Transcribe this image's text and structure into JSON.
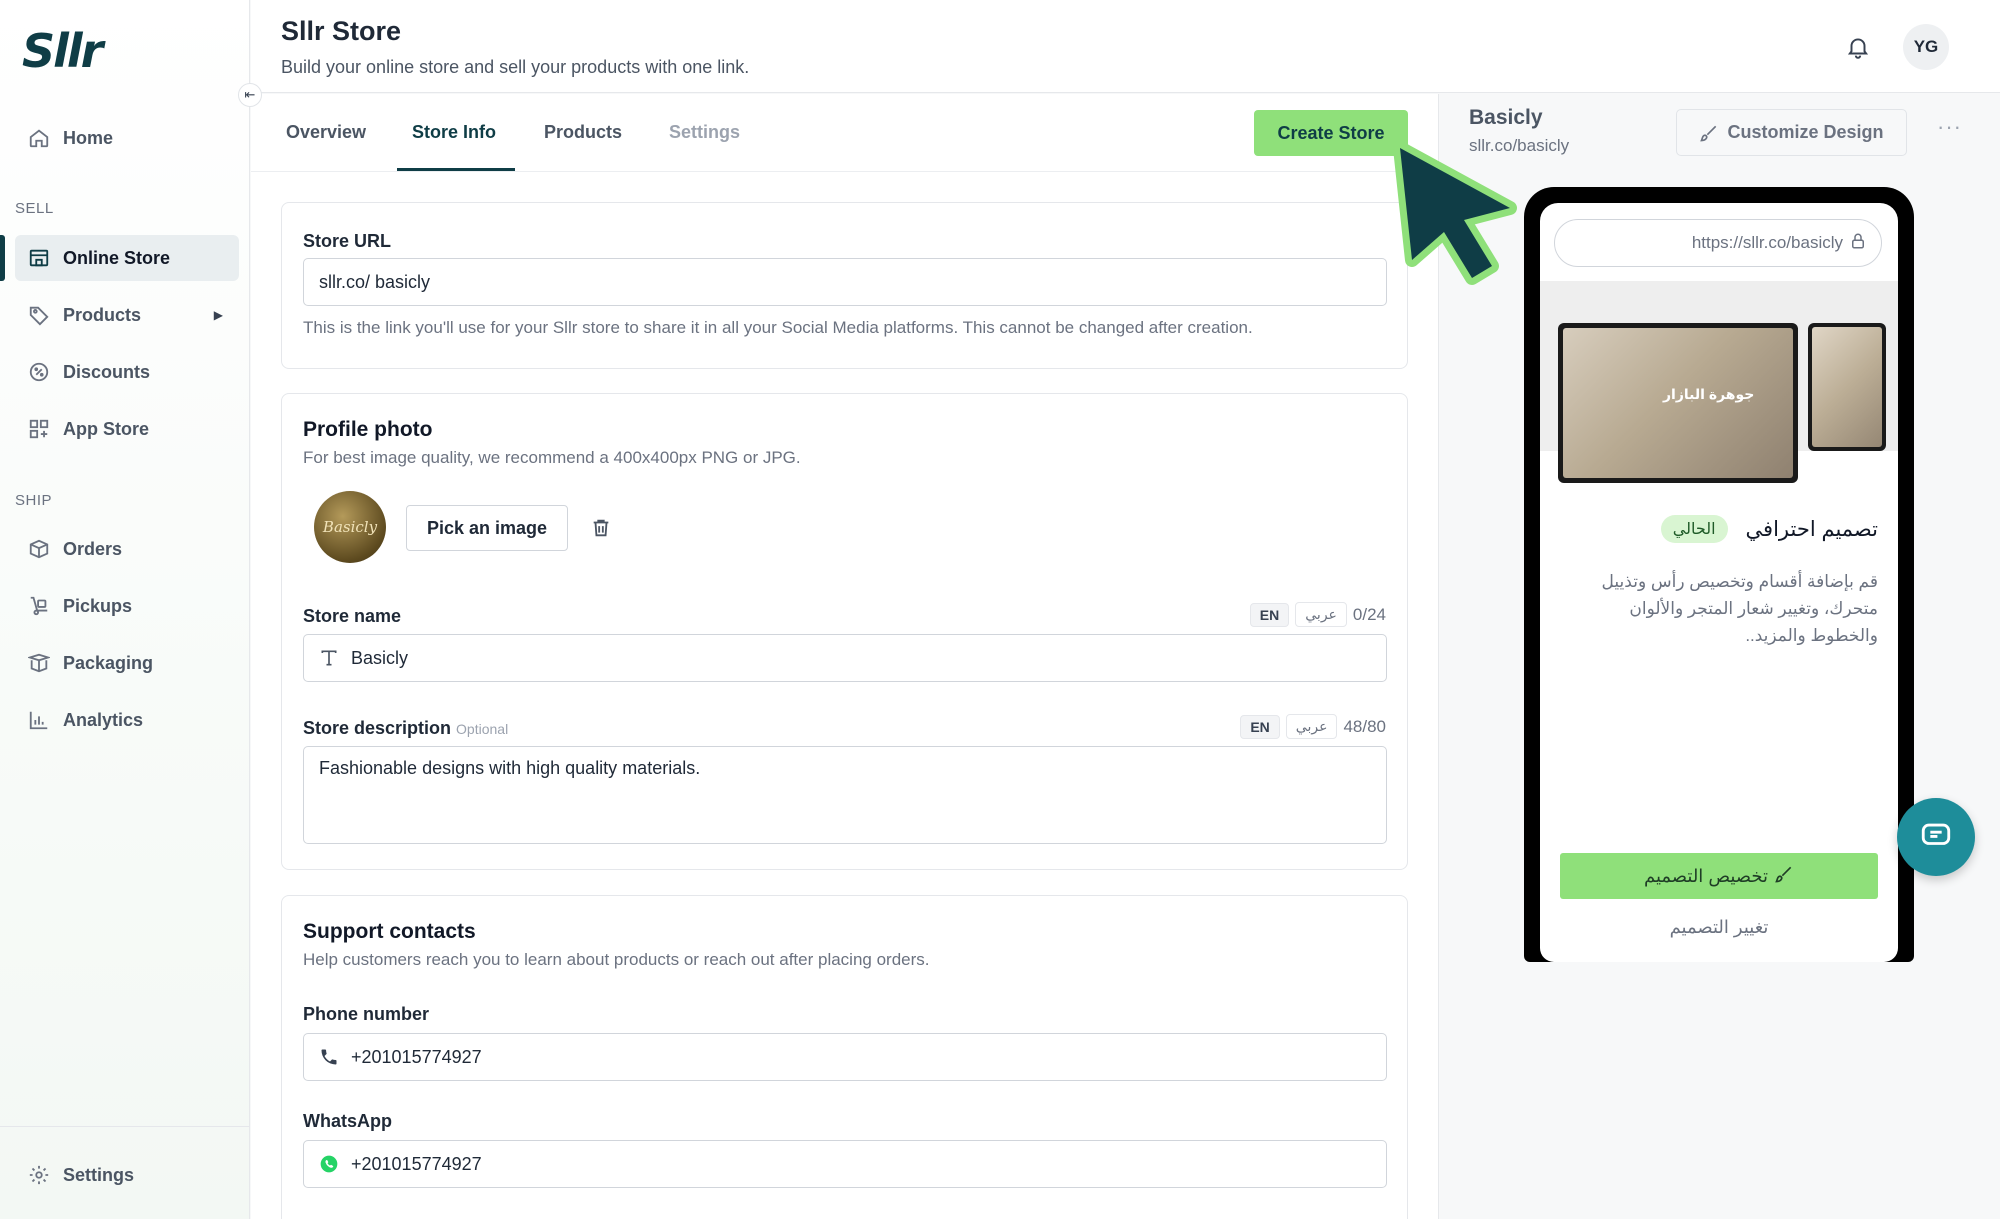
{
  "app": {
    "logo_text": "Sllr"
  },
  "sidebar": {
    "home": "Home",
    "sell_section": "SELL",
    "online_store": "Online Store",
    "products": "Products",
    "discounts": "Discounts",
    "app_store": "App Store",
    "ship_section": "SHIP",
    "orders": "Orders",
    "pickups": "Pickups",
    "packaging": "Packaging",
    "analytics": "Analytics",
    "settings": "Settings"
  },
  "header": {
    "title": "Sllr Store",
    "subtitle": "Build your online store and sell your products with one link.",
    "avatar_initials": "YG"
  },
  "tabs": {
    "overview": "Overview",
    "store_info": "Store Info",
    "products": "Products",
    "settings": "Settings",
    "active": "Store Info"
  },
  "actions": {
    "create_store": "Create Store"
  },
  "store_url": {
    "label": "Store URL",
    "value": "sllr.co/ basicly",
    "help": "This is the link you'll use for your Sllr store to share it in all your Social Media platforms. This cannot be changed after creation."
  },
  "profile": {
    "title": "Profile photo",
    "help": "For best image quality, we recommend a 400x400px PNG or JPG.",
    "image_text": "Basicly",
    "pick_button": "Pick an image"
  },
  "store_name": {
    "label": "Store name",
    "lang_en": "EN",
    "lang_ar": "عربي",
    "counter": "0/24",
    "value": "Basicly"
  },
  "store_description": {
    "label": "Store description",
    "optional": "Optional",
    "lang_en": "EN",
    "lang_ar": "عربي",
    "counter": "48/80",
    "value": "Fashionable designs with high quality materials."
  },
  "support": {
    "title": "Support contacts",
    "help": "Help customers reach you to learn about products or reach out after placing orders.",
    "phone_label": "Phone number",
    "phone_value": "+201015774927",
    "whatsapp_label": "WhatsApp",
    "whatsapp_value": "+201015774927"
  },
  "preview": {
    "store_name": "Basicly",
    "store_url": "sllr.co/basicly",
    "customize_button": "Customize Design",
    "phone_url": "https://sllr.co/basicly",
    "theme_name": "تصميم احترافي",
    "current_badge": "الحالي",
    "theme_description": "قم بإضافة أقسام وتخصيص رأس وتذييل متحرك، وتغيير شعار المتجر والألوان والخطوط والمزيد..",
    "customize_ar": "تخصيص التصميم",
    "change_ar": "تغيير التصميم",
    "mock_text": "جوهرة البازار"
  },
  "colors": {
    "brand_dark": "#0f3d46",
    "accent_green": "#8fe07a",
    "chat_teal": "#1e8d9a"
  }
}
